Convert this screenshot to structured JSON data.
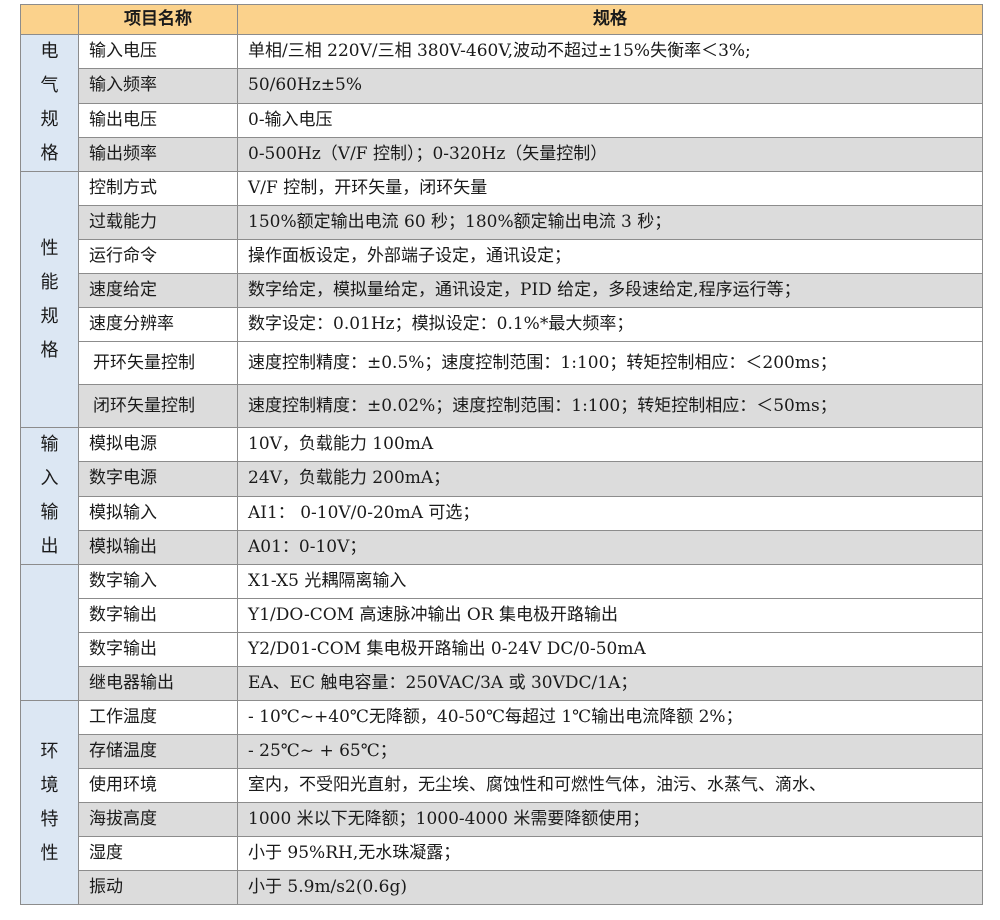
{
  "header": {
    "col_group": "",
    "col_name": "项目名称",
    "col_spec": "规格"
  },
  "groups": [
    {
      "label": [
        "电",
        "气",
        "规",
        "格"
      ],
      "rows": [
        {
          "name": "输入电压",
          "value": "单相/三相 220V/三相 380V-460V,波动不超过±15%失衡率＜3%;"
        },
        {
          "name": "输入频率",
          "value": "50/60Hz±5%"
        },
        {
          "name": "输出电压",
          "value": "0-输入电压"
        },
        {
          "name": "输出频率",
          "value": "0-500Hz（V/F 控制）；0-320Hz（矢量控制）"
        }
      ]
    },
    {
      "label": [
        "性",
        "能",
        "规",
        "格"
      ],
      "rows": [
        {
          "name": "控制方式",
          "value": "V/F 控制，开环矢量，闭环矢量"
        },
        {
          "name": "过载能力",
          "value": "150%额定输出电流 60 秒；180%额定输出电流 3 秒；"
        },
        {
          "name": "运行命令",
          "value": "操作面板设定，外部端子设定，通讯设定；"
        },
        {
          "name": "速度给定",
          "value": "数字给定，模拟量给定，通讯设定，PID 给定，多段速给定,程序运行等；"
        },
        {
          "name": "速度分辨率",
          "value": "数字设定：0.01Hz；模拟设定：0.1%*最大频率；"
        },
        {
          "name": "开环矢量控制",
          "value": "速度控制精度：±0.5%；速度控制范围：1:100；转矩控制相应：＜200ms；"
        },
        {
          "name": "闭环矢量控制",
          "value": "速度控制精度：±0.02%；速度控制范围：1:100；转矩控制相应：＜50ms；"
        }
      ]
    },
    {
      "label": [
        "输",
        "入",
        "输",
        "出"
      ],
      "rows": [
        {
          "name": "模拟电源",
          "value": "10V，负载能力 100mA"
        },
        {
          "name": "数字电源",
          "value": "24V，负载能力 200mA；"
        },
        {
          "name": "模拟输入",
          "value": "AI1： 0-10V/0-20mA 可选；"
        },
        {
          "name": "模拟输出",
          "value": "A01：0-10V；"
        }
      ]
    },
    {
      "label": [],
      "rows": [
        {
          "name": "数字输入",
          "value": "X1-X5 光耦隔离输入"
        },
        {
          "name": "数字输出",
          "value": "Y1/DO-COM 高速脉冲输出 OR 集电极开路输出"
        },
        {
          "name": "数字输出",
          "value": "Y2/D01-COM 集电极开路输出 0-24V DC/0-50mA"
        },
        {
          "name": "继电器输出",
          "value": "EA、EC 触电容量：250VAC/3A 或 30VDC/1A；"
        }
      ]
    },
    {
      "label": [
        "环",
        "境",
        "特",
        "性"
      ],
      "rows": [
        {
          "name": "工作温度",
          "value": " - 10℃~+40℃无降额，40-50℃每超过 1℃输出电流降额 2%；"
        },
        {
          "name": "存储温度",
          "value": " - 25℃~ + 65℃；"
        },
        {
          "name": "使用环境",
          "value": "室内，不受阳光直射，无尘埃、腐蚀性和可燃性气体，油污、水蒸气、滴水、"
        },
        {
          "name": "海拔高度",
          "value": "1000 米以下无降额；1000-4000 米需要降额使用；"
        },
        {
          "name": "湿度",
          "value": "小于 95%RH,无水珠凝露；"
        },
        {
          "name": "振动",
          "value": "小于 5.9m/s2(0.6g)"
        }
      ]
    }
  ]
}
